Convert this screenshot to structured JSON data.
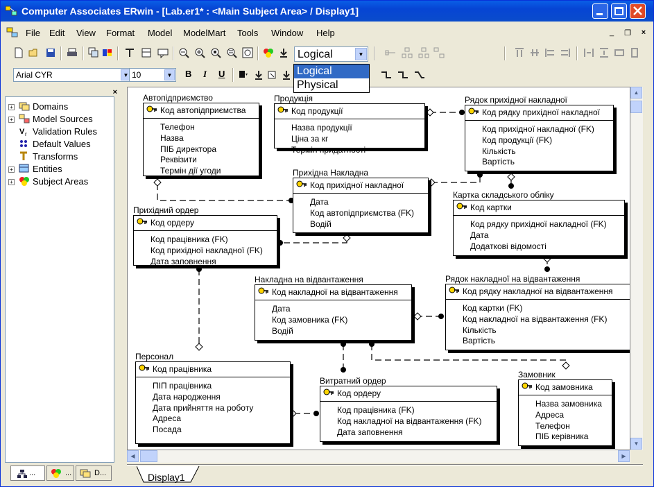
{
  "window": {
    "title": "Computer Associates ERwin - [Lab.er1* : <Main Subject Area> / Display1]"
  },
  "menu": [
    "File",
    "Edit",
    "View",
    "Format",
    "Model",
    "ModelMart",
    "Tools",
    "Window",
    "Help"
  ],
  "toolbar": {
    "view_mode": "Logical",
    "view_options": [
      "Logical",
      "Physical"
    ],
    "font_name": "Arial CYR",
    "font_size": "10",
    "bold": "B",
    "italic": "I",
    "underline": "U"
  },
  "tree": {
    "items": [
      "Domains",
      "Model Sources",
      "Validation Rules",
      "Default Values",
      "Transforms",
      "Entities",
      "Subject Areas"
    ],
    "tabs": [
      "...",
      "...",
      "D..."
    ]
  },
  "canvas_tab": "Display1",
  "entities": [
    {
      "name": "Автопідприємство",
      "pk": "Код автопідприємства",
      "attrs": [
        "Телефон",
        "Назва",
        "ПІБ директора",
        "Реквізити",
        "Термін дії угоди"
      ]
    },
    {
      "name": "Продукція",
      "pk": "Код продукції",
      "attrs": [
        "Назва продукції",
        "Ціна за кг",
        "Термін придатності"
      ]
    },
    {
      "name": "Рядок прихідної накладної",
      "pk": "Код рядку прихідної накладної",
      "attrs": [
        "Код прихідної накладної (FK)",
        "Код продукції (FK)",
        "Кількість",
        "Вартість"
      ]
    },
    {
      "name": "Прихідна Накладна",
      "pk": "Код прихідної накладної",
      "attrs": [
        "Дата",
        "Код автопідприємства (FK)",
        "Водій"
      ]
    },
    {
      "name": "Картка складського обліку",
      "pk": "Код картки",
      "attrs": [
        "Код рядку прихідної накладної (FK)",
        "Дата",
        "Додаткові відомості"
      ]
    },
    {
      "name": "Прихідний ордер",
      "pk": "Код ордеру",
      "attrs": [
        "Код працівника (FK)",
        "Код прихідної накладної (FK)",
        "Дата заповнення"
      ]
    },
    {
      "name": "Накладна на відвантаження",
      "pk": "Код накладної на відвантаження",
      "attrs": [
        "Дата",
        "Код замовника (FK)",
        "Водій"
      ]
    },
    {
      "name": "Рядок накладної на відвантаження",
      "pk": "Код рядку накладної на відвантаження",
      "attrs": [
        "Код картки (FK)",
        "Код накладної на відвантаження (FK)",
        "Кількість",
        "Вартість"
      ]
    },
    {
      "name": "Персонал",
      "pk": "Код працівника",
      "attrs": [
        "ПІП працівника",
        "Дата народження",
        "Дата прийняття на роботу",
        "Адреса",
        "Посада"
      ]
    },
    {
      "name": "Витратний ордер",
      "pk": "Код ордеру",
      "attrs": [
        "Код працівника (FK)",
        "Код накладної на відвантаження (FK)",
        "Дата заповнення"
      ]
    },
    {
      "name": "Замовник",
      "pk": "Код замовника",
      "attrs": [
        "Назва замовника",
        "Адреса",
        "Телефон",
        "ПІБ керівника"
      ]
    }
  ]
}
